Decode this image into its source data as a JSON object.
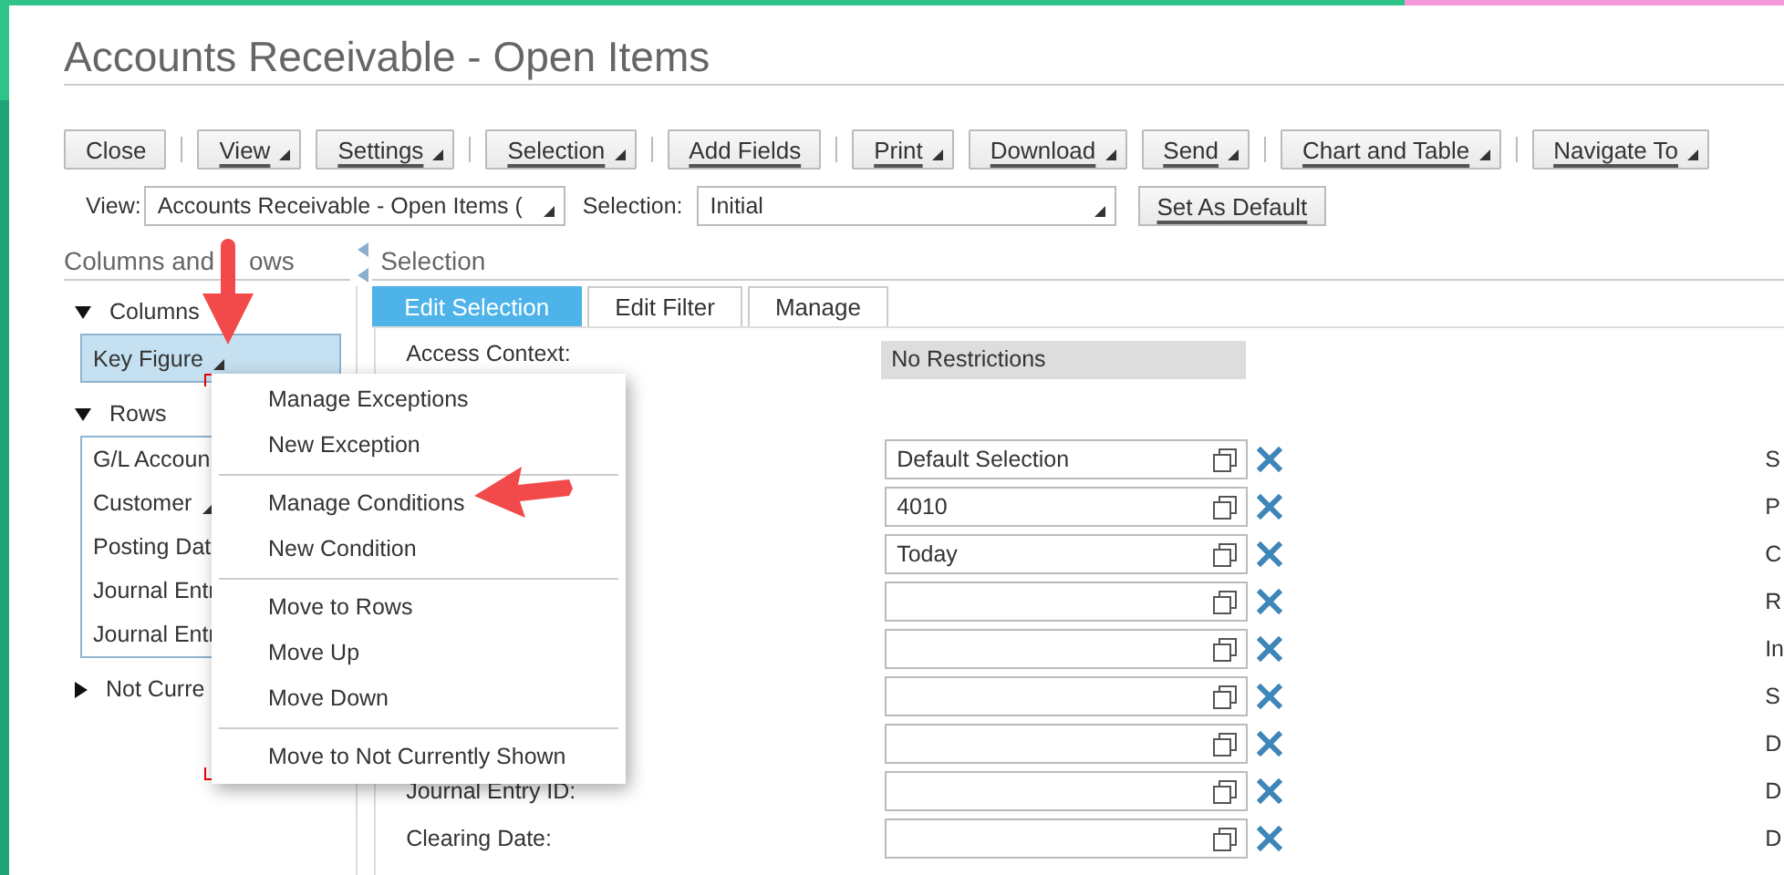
{
  "window": {
    "title": "Accounts Receivable - Open Items"
  },
  "toolbar": [
    [
      {
        "label": "Close",
        "underlined": false,
        "dropdown": false
      }
    ],
    [
      {
        "label": "View",
        "underlined": true,
        "dropdown": true
      },
      {
        "label": "Settings",
        "underlined": true,
        "dropdown": true
      }
    ],
    [
      {
        "label": "Selection",
        "underlined": true,
        "dropdown": true
      }
    ],
    [
      {
        "label": "Add Fields",
        "underlined": true,
        "dropdown": false
      }
    ],
    [
      {
        "label": "Print",
        "underlined": true,
        "dropdown": true
      },
      {
        "label": "Download",
        "underlined": true,
        "dropdown": true
      },
      {
        "label": "Send",
        "underlined": true,
        "dropdown": true
      }
    ],
    [
      {
        "label": "Chart and Table",
        "underlined": true,
        "dropdown": true
      }
    ],
    [
      {
        "label": "Navigate To",
        "underlined": true,
        "dropdown": true
      }
    ]
  ],
  "view_bar": {
    "view_label": "View:",
    "view_value": "Accounts Receivable - Open Items (",
    "selection_label": "Selection:",
    "selection_value": "Initial",
    "default_button": "Set As Default"
  },
  "columns_rows": {
    "title": [
      "Columns and",
      "ows"
    ],
    "groups": [
      {
        "label": "Columns",
        "expanded": true,
        "items": [
          {
            "label": "Key Figure",
            "dropdown": true,
            "selected": true,
            "pointed": true
          }
        ]
      },
      {
        "label": "Rows",
        "expanded": true,
        "items": [
          {
            "label": "G/L Accoun",
            "dropdown": false,
            "selected": false,
            "pointed": false
          },
          {
            "label": "Customer",
            "dropdown": true,
            "selected": false,
            "pointed": false
          },
          {
            "label": "Posting Dat",
            "dropdown": false,
            "selected": false,
            "pointed": false
          },
          {
            "label": "Journal Entr",
            "dropdown": false,
            "selected": false,
            "pointed": false
          },
          {
            "label": "Journal Entr",
            "dropdown": false,
            "selected": false,
            "pointed": false
          }
        ]
      },
      {
        "label": "Not Curre",
        "expanded": false
      }
    ]
  },
  "selection": {
    "title": "Selection",
    "tabs": [
      {
        "label": "Edit Selection",
        "selected": true
      },
      {
        "label": "Edit Filter",
        "selected": false
      },
      {
        "label": "Manage",
        "selected": false
      }
    ],
    "access_context": {
      "label": "Access Context:",
      "value": "No Restrictions"
    },
    "rows": [
      {
        "value": "Default Selection",
        "column_3": "S"
      },
      {
        "value": "4010",
        "column_3": "P"
      },
      {
        "value": "Today",
        "column_3": "C"
      },
      {
        "column_3": "R"
      },
      {
        "column_3": "In"
      },
      {
        "column_3": "S"
      },
      {
        "column_3": "D"
      },
      {
        "label": "Journal Entry ID:",
        "column_3": "D"
      },
      {
        "label": "Clearing Date:",
        "column_3": "D"
      }
    ]
  },
  "context_menu": {
    "focused": true,
    "groups": [
      [
        {
          "label": "Manage Exceptions",
          "pointed": false
        },
        {
          "label": "New Exception",
          "pointed": false
        }
      ],
      [
        {
          "label": "Manage Conditions",
          "pointed": true
        },
        {
          "label": "New Condition",
          "pointed": false
        }
      ],
      [
        {
          "label": "Move to Rows",
          "pointed": false
        },
        {
          "label": "Move Up",
          "pointed": false
        },
        {
          "label": "Move Down",
          "pointed": false
        }
      ],
      [
        {
          "label": "Move to Not Currently Shown",
          "pointed": false
        }
      ]
    ]
  }
}
